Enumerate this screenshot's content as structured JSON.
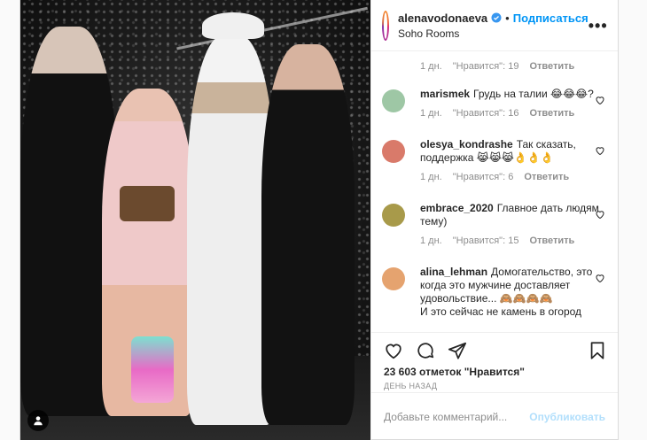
{
  "header": {
    "username": "alenavodonaeva",
    "separator": "•",
    "follow_label": "Подписаться",
    "location": "Soho Rooms",
    "more_icon": "more-horizontal-icon"
  },
  "first_comment_meta": {
    "time": "1 дн.",
    "likes": "\"Нравится\": 19",
    "reply": "Ответить"
  },
  "comments": [
    {
      "user": "marismek",
      "text": "Грудь на талии 😂😂😂?",
      "time": "1 дн.",
      "likes": "\"Нравится\": 16",
      "reply": "Ответить",
      "avatar_color": "#9ec7a5"
    },
    {
      "user": "olesya_kondrashe",
      "text": "Так сказать, поддержка 😹😹😹👌👌👌",
      "time": "1 дн.",
      "likes": "\"Нравится\": 6",
      "reply": "Ответить",
      "avatar_color": "#d97a6a"
    },
    {
      "user": "embrace_2020",
      "text": "Главное дать людям тему)",
      "time": "1 дн.",
      "likes": "\"Нравится\": 15",
      "reply": "Ответить",
      "avatar_color": "#a89a4a"
    },
    {
      "user": "alina_lehman",
      "text": "Домогательство, это когда это мужчине доставляет удовольствие... 🙈🙈🙈🙈",
      "extra": "И это сейчас не камень в огород",
      "avatar_color": "#e5a36f"
    }
  ],
  "actions": {
    "like_icon": "heart-icon",
    "comment_icon": "comment-icon",
    "share_icon": "share-icon",
    "save_icon": "bookmark-icon"
  },
  "likes": "23 603 отметок \"Нравится\"",
  "time_ago": "ДЕНЬ НАЗАД",
  "add_comment": {
    "placeholder": "Добавьте комментарий...",
    "publish_label": "Опубликовать"
  },
  "colors": {
    "accent": "#0095f6",
    "muted": "#8e8e8e",
    "publish_disabled": "#b2dffc"
  }
}
